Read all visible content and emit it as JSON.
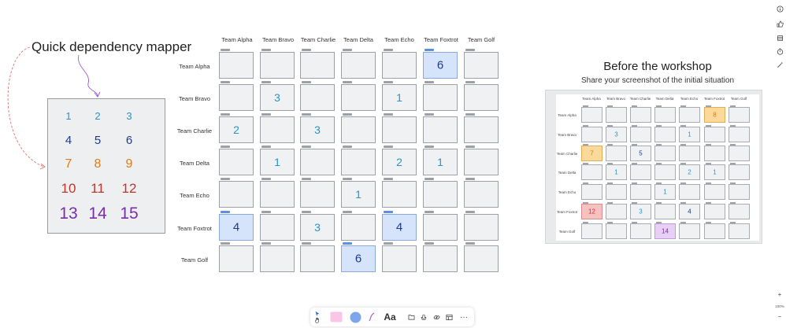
{
  "board": {
    "title": "Quick dependency mapper"
  },
  "legend": {
    "numbers": [
      {
        "label": "1",
        "color": "#2a93c8"
      },
      {
        "label": "2",
        "color": "#2a93c8"
      },
      {
        "label": "3",
        "color": "#2a93c8"
      },
      {
        "label": "4",
        "color": "#1e3a8a"
      },
      {
        "label": "5",
        "color": "#1e3a8a"
      },
      {
        "label": "6",
        "color": "#1e3a8a"
      },
      {
        "label": "7",
        "color": "#e07b12"
      },
      {
        "label": "8",
        "color": "#e07b12"
      },
      {
        "label": "9",
        "color": "#e07b12"
      },
      {
        "label": "10",
        "color": "#c2352b"
      },
      {
        "label": "11",
        "color": "#c2352b"
      },
      {
        "label": "12",
        "color": "#c2352b"
      },
      {
        "label": "13",
        "color": "#7a2ea8"
      },
      {
        "label": "14",
        "color": "#7a2ea8"
      },
      {
        "label": "15",
        "color": "#7a2ea8"
      }
    ]
  },
  "matrix": {
    "columns": [
      "Team Alpha",
      "Team Bravo",
      "Team Charlie",
      "Team Delta",
      "Team Echo",
      "Team Foxtrot",
      "Team Golf"
    ],
    "rows": [
      "Team Alpha",
      "Team Bravo",
      "Team Charlie",
      "Team Delta",
      "Team Echo",
      "Team Foxtrot",
      "Team Golf"
    ],
    "cells": [
      [
        {
          "v": "",
          "s": ""
        },
        {
          "v": "",
          "s": ""
        },
        {
          "v": "",
          "s": ""
        },
        {
          "v": "",
          "s": ""
        },
        {
          "v": "",
          "s": ""
        },
        {
          "v": "6",
          "s": "blue"
        },
        {
          "v": "",
          "s": ""
        }
      ],
      [
        {
          "v": "",
          "s": ""
        },
        {
          "v": "3",
          "s": ""
        },
        {
          "v": "",
          "s": ""
        },
        {
          "v": "",
          "s": ""
        },
        {
          "v": "1",
          "s": ""
        },
        {
          "v": "",
          "s": ""
        },
        {
          "v": "",
          "s": ""
        }
      ],
      [
        {
          "v": "2",
          "s": ""
        },
        {
          "v": "",
          "s": ""
        },
        {
          "v": "3",
          "s": ""
        },
        {
          "v": "",
          "s": ""
        },
        {
          "v": "",
          "s": ""
        },
        {
          "v": "",
          "s": ""
        },
        {
          "v": "",
          "s": ""
        }
      ],
      [
        {
          "v": "",
          "s": ""
        },
        {
          "v": "1",
          "s": ""
        },
        {
          "v": "",
          "s": ""
        },
        {
          "v": "",
          "s": ""
        },
        {
          "v": "2",
          "s": ""
        },
        {
          "v": "1",
          "s": ""
        },
        {
          "v": "",
          "s": ""
        }
      ],
      [
        {
          "v": "",
          "s": ""
        },
        {
          "v": "",
          "s": ""
        },
        {
          "v": "",
          "s": ""
        },
        {
          "v": "1",
          "s": ""
        },
        {
          "v": "",
          "s": ""
        },
        {
          "v": "",
          "s": ""
        },
        {
          "v": "",
          "s": ""
        }
      ],
      [
        {
          "v": "4",
          "s": "blue"
        },
        {
          "v": "",
          "s": ""
        },
        {
          "v": "3",
          "s": ""
        },
        {
          "v": "",
          "s": ""
        },
        {
          "v": "4",
          "s": "blue"
        },
        {
          "v": "",
          "s": ""
        },
        {
          "v": "",
          "s": ""
        }
      ],
      [
        {
          "v": "",
          "s": ""
        },
        {
          "v": "",
          "s": ""
        },
        {
          "v": "",
          "s": ""
        },
        {
          "v": "6",
          "s": "blue"
        },
        {
          "v": "",
          "s": ""
        },
        {
          "v": "",
          "s": ""
        },
        {
          "v": "",
          "s": ""
        }
      ]
    ]
  },
  "frame": {
    "title": "Before the workshop",
    "subtitle": "Share your screenshot of the initial situation",
    "columns": [
      "Team Alpha",
      "Team Bravo",
      "Team Charlie",
      "Team Delta",
      "Team Echo",
      "Team Foxtrot",
      "Team Golf"
    ],
    "rows": [
      "Team Alpha",
      "Team Bravo",
      "Team Charlie",
      "Team Delta",
      "Team Echo",
      "Team Foxtrot",
      "Team Golf"
    ],
    "cells": [
      [
        {
          "v": "",
          "s": ""
        },
        {
          "v": "",
          "s": ""
        },
        {
          "v": "",
          "s": ""
        },
        {
          "v": "",
          "s": ""
        },
        {
          "v": "",
          "s": ""
        },
        {
          "v": "8",
          "s": "orange"
        },
        {
          "v": "",
          "s": ""
        }
      ],
      [
        {
          "v": "",
          "s": ""
        },
        {
          "v": "3",
          "s": ""
        },
        {
          "v": "",
          "s": ""
        },
        {
          "v": "",
          "s": ""
        },
        {
          "v": "1",
          "s": ""
        },
        {
          "v": "",
          "s": ""
        },
        {
          "v": "",
          "s": ""
        }
      ],
      [
        {
          "v": "7",
          "s": "orange"
        },
        {
          "v": "",
          "s": ""
        },
        {
          "v": "5",
          "s": "dark"
        },
        {
          "v": "",
          "s": ""
        },
        {
          "v": "",
          "s": ""
        },
        {
          "v": "",
          "s": ""
        },
        {
          "v": "",
          "s": ""
        }
      ],
      [
        {
          "v": "",
          "s": ""
        },
        {
          "v": "1",
          "s": ""
        },
        {
          "v": "",
          "s": ""
        },
        {
          "v": "",
          "s": ""
        },
        {
          "v": "2",
          "s": ""
        },
        {
          "v": "1",
          "s": ""
        },
        {
          "v": "",
          "s": ""
        }
      ],
      [
        {
          "v": "",
          "s": ""
        },
        {
          "v": "",
          "s": ""
        },
        {
          "v": "",
          "s": ""
        },
        {
          "v": "1",
          "s": ""
        },
        {
          "v": "",
          "s": ""
        },
        {
          "v": "",
          "s": ""
        },
        {
          "v": "",
          "s": ""
        }
      ],
      [
        {
          "v": "12",
          "s": "red"
        },
        {
          "v": "",
          "s": ""
        },
        {
          "v": "3",
          "s": ""
        },
        {
          "v": "",
          "s": ""
        },
        {
          "v": "4",
          "s": "dark"
        },
        {
          "v": "",
          "s": ""
        },
        {
          "v": "",
          "s": ""
        }
      ],
      [
        {
          "v": "",
          "s": ""
        },
        {
          "v": "",
          "s": ""
        },
        {
          "v": "",
          "s": ""
        },
        {
          "v": "14",
          "s": "purple"
        },
        {
          "v": "",
          "s": ""
        },
        {
          "v": "",
          "s": ""
        },
        {
          "v": "",
          "s": ""
        }
      ]
    ]
  },
  "rail": {
    "icons": [
      "info-icon",
      "thumbs-up-icon",
      "database-icon",
      "timer-icon",
      "magic-wand-icon"
    ],
    "zoom_in": "+",
    "zoom_level": "100%",
    "zoom_out": "−"
  },
  "toolbar": {
    "text_tool": "Aa",
    "more": "···"
  }
}
